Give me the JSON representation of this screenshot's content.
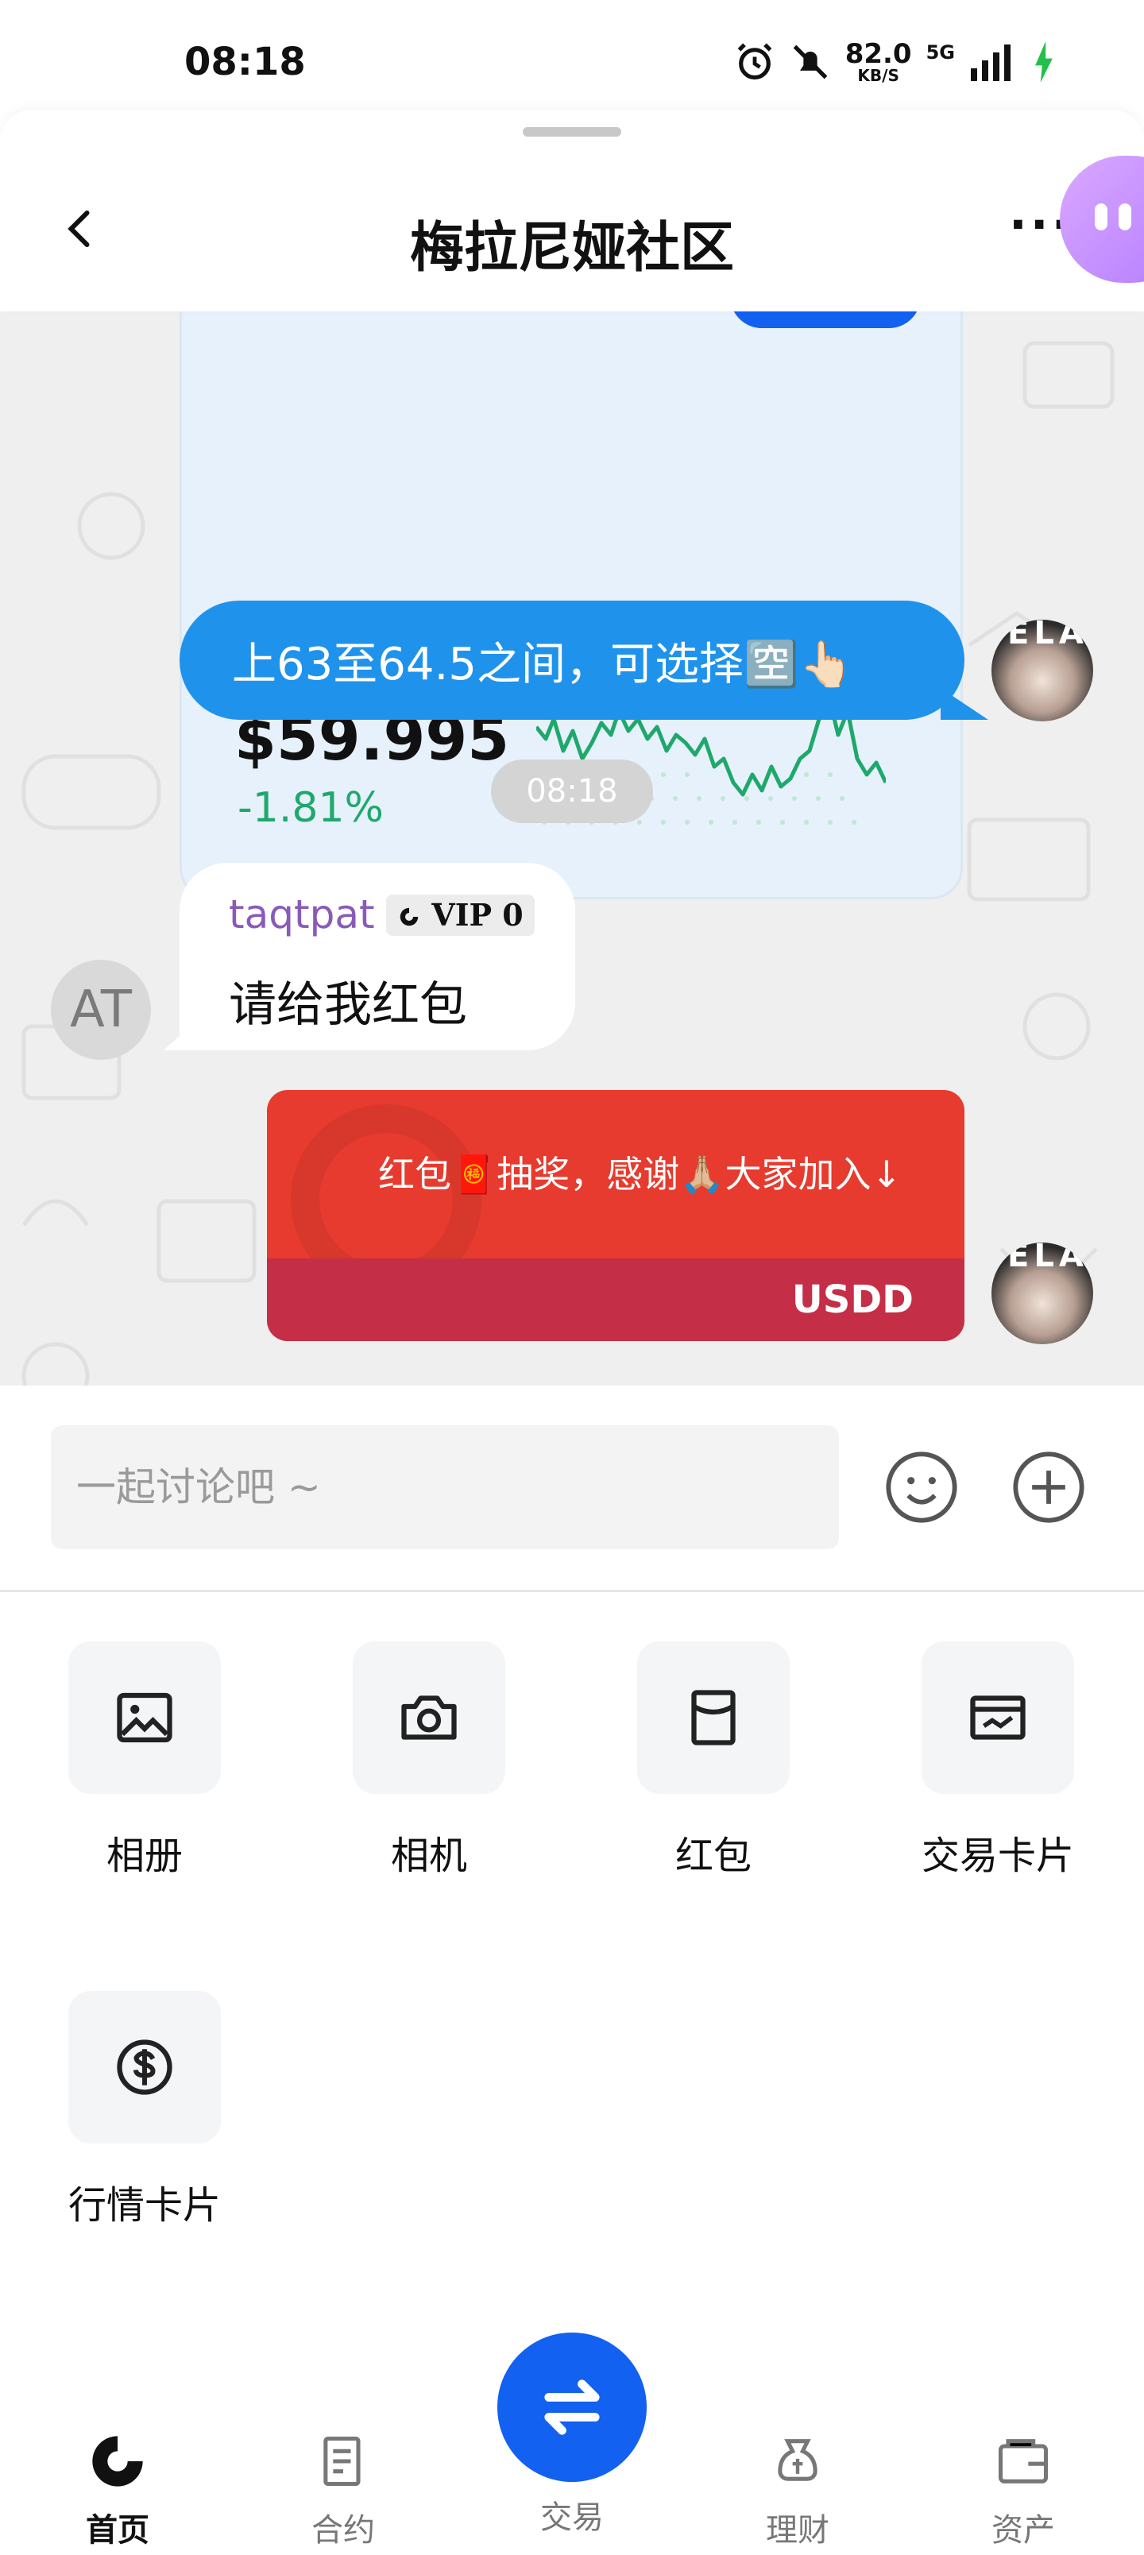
{
  "status_bar": {
    "time": "08:18",
    "net_speed": "82.0",
    "net_unit": "KB/S",
    "network": "5G"
  },
  "header": {
    "title": "梅拉尼娅社区",
    "more": "···"
  },
  "market_card": {
    "price": "$59.995",
    "change": "-1.81%",
    "change_color": "#1fa86b"
  },
  "messages": {
    "blue_text": "上63至64.5之间，可选择🈳👆🏻",
    "timestamp": "08:18",
    "user": {
      "avatar_initials": "AT",
      "name": "taqtpat",
      "vip": "VIP 0",
      "text": "请给我红包"
    },
    "red_packet": {
      "title": "红包🧧抽奖，感谢🙏🏼大家加入↓",
      "currency": "USDD"
    },
    "avatar_text": "ELAI"
  },
  "input": {
    "placeholder": "一起讨论吧 ~"
  },
  "actions": [
    {
      "label": "相册",
      "icon": "photo-icon"
    },
    {
      "label": "相机",
      "icon": "camera-icon"
    },
    {
      "label": "红包",
      "icon": "red-packet-icon"
    },
    {
      "label": "交易卡片",
      "icon": "trade-card-icon"
    },
    {
      "label": "行情卡片",
      "icon": "dollar-icon"
    }
  ],
  "bottom_nav": {
    "home": "首页",
    "contract": "合约",
    "trade": "交易",
    "finance": "理财",
    "assets": "资产"
  },
  "colors": {
    "accent": "#1261f0",
    "bubble_blue": "#1f92ec",
    "red_packet": "#e63b2e",
    "red_packet_footer": "#c52e47"
  }
}
